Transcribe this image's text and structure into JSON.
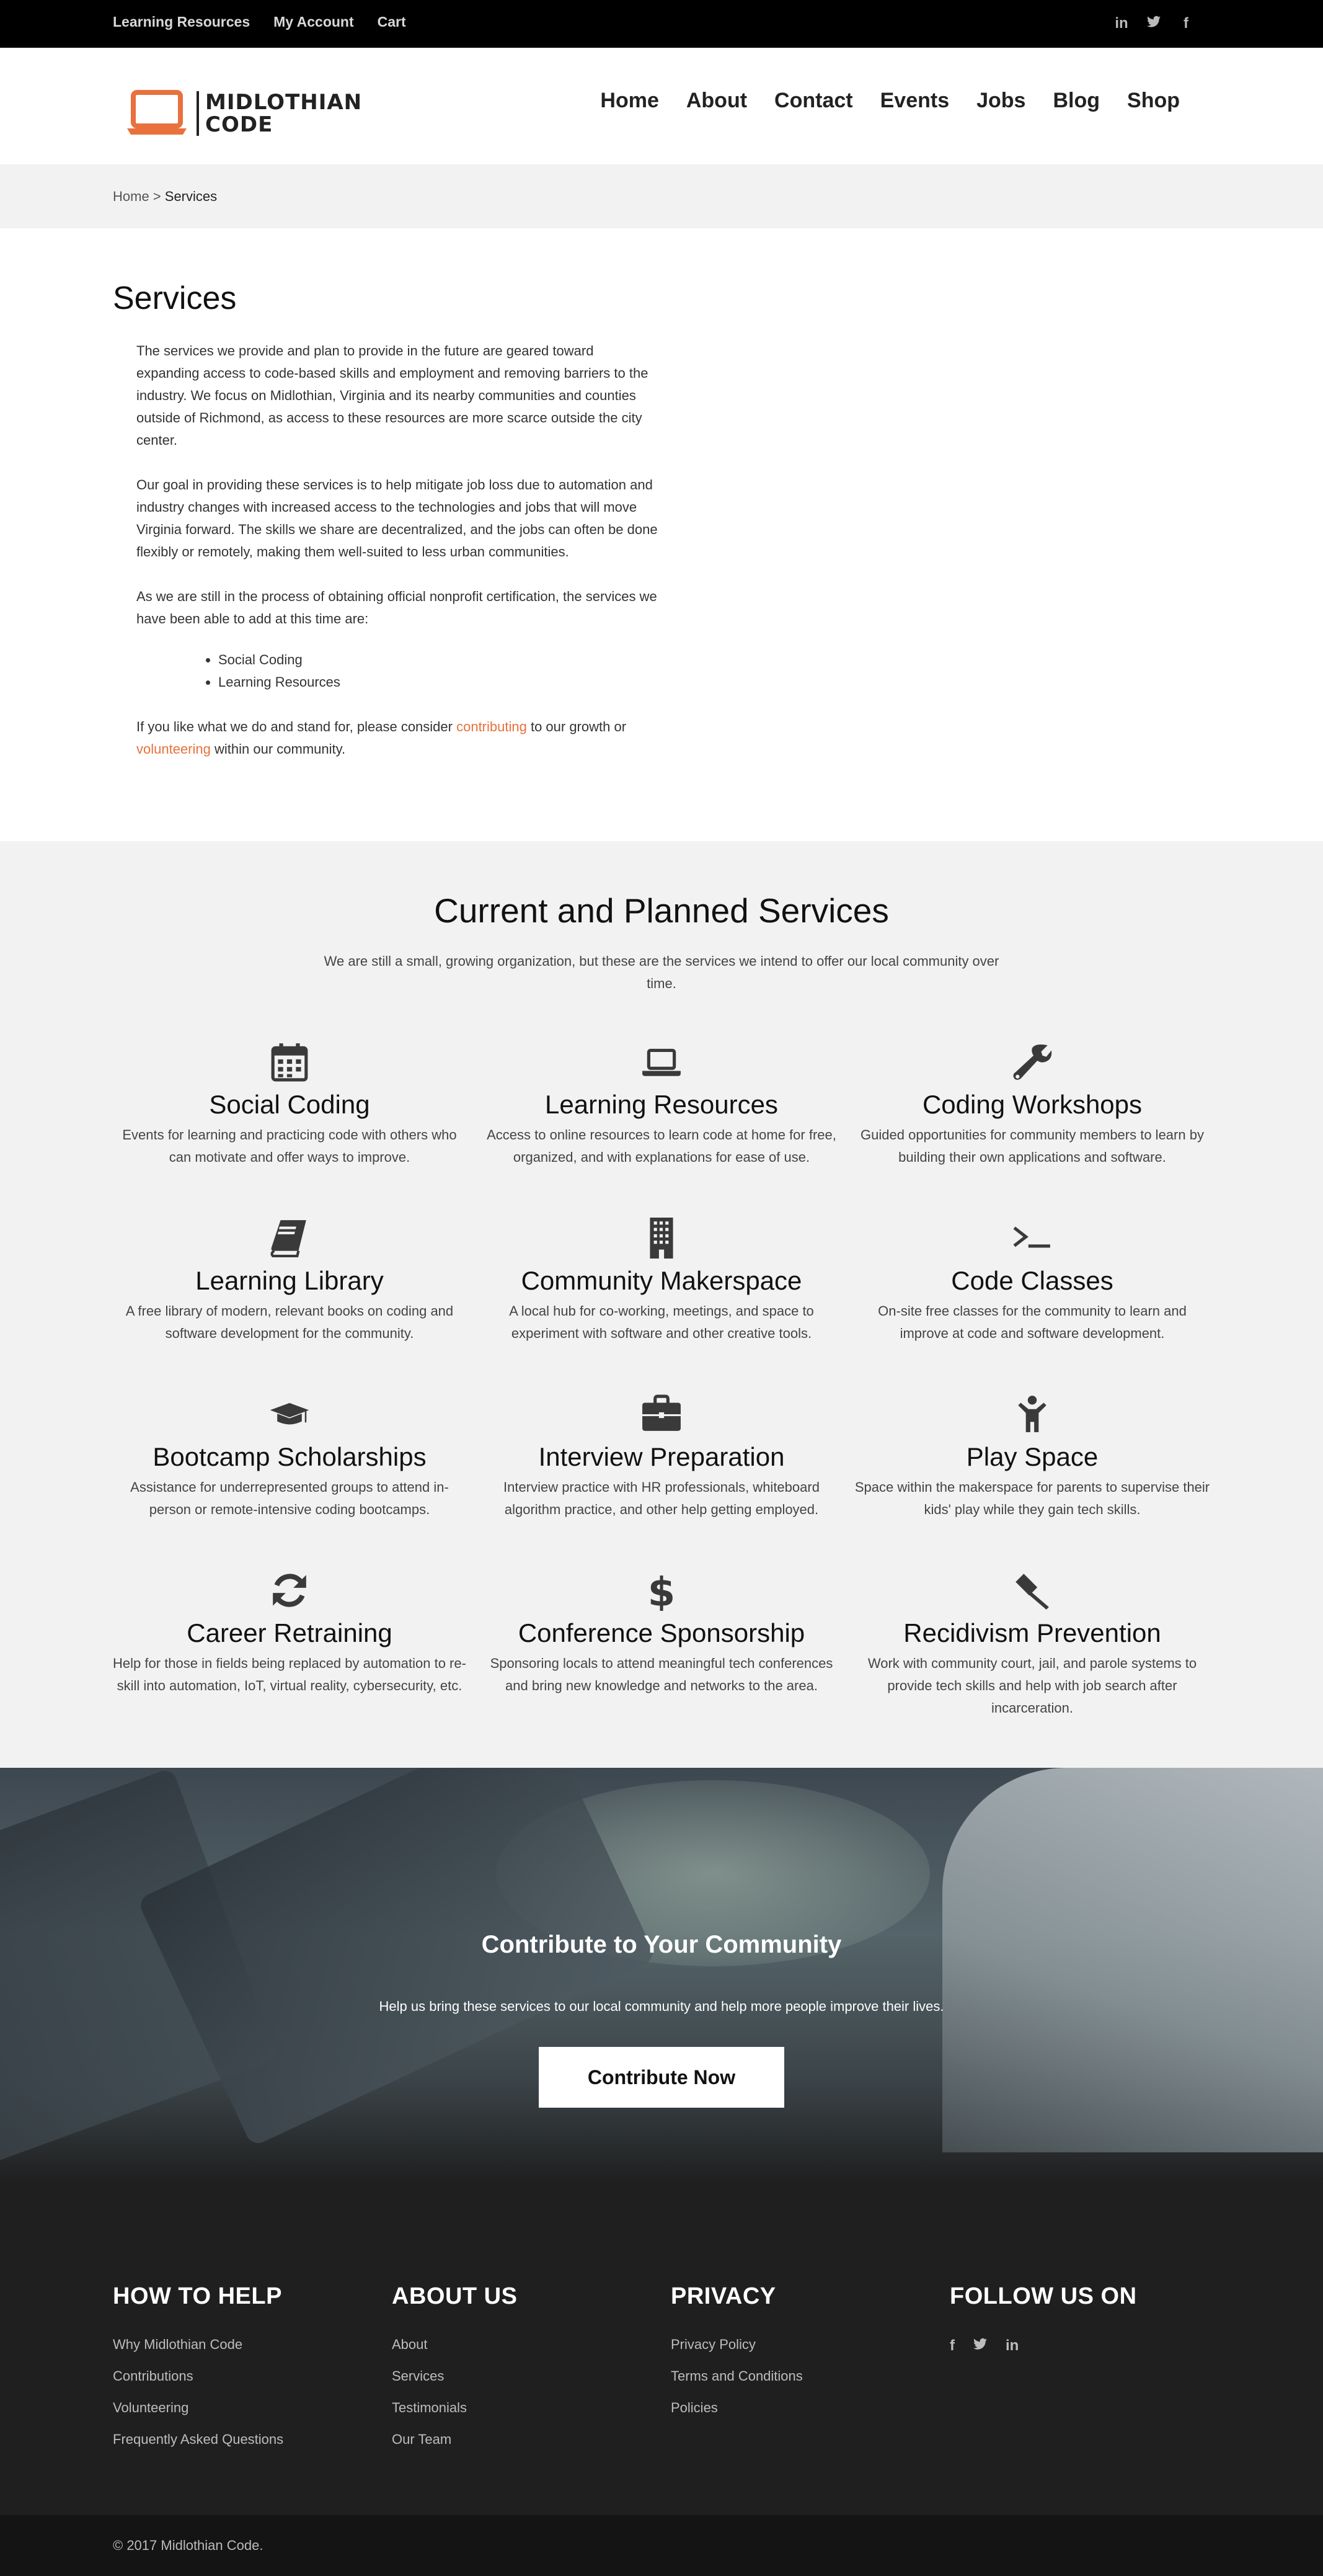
{
  "topbar": {
    "links": [
      "Learning Resources",
      "My Account",
      "Cart"
    ],
    "social": [
      "in",
      "t",
      "f"
    ]
  },
  "header": {
    "logo_line1": "MIDLOTHIAN",
    "logo_line2": "CODE",
    "nav": [
      "Home",
      "About",
      "Contact",
      "Events",
      "Jobs",
      "Blog",
      "Shop"
    ]
  },
  "breadcrumb": {
    "home": "Home",
    "sep": " > ",
    "current": "Services"
  },
  "intro": {
    "title": "Services",
    "p1": "The services we provide and plan to provide in the future are geared toward expanding access to code-based skills and employment and removing barriers to the industry. We focus on Midlothian, Virginia and its nearby communities and counties outside of Richmond, as access to these resources are more scarce outside the city center.",
    "p2": "Our goal in providing these services is to help mitigate job loss due to automation and industry changes with increased access to the technologies and jobs that will move Virginia forward. The skills we share are decentralized, and the jobs can often be done flexibly or remotely, making them well-suited to less urban communities.",
    "p3": "As we are still in the process of obtaining official nonprofit certification, the services we have been able to add at this time are:",
    "list": [
      "Social Coding",
      "Learning Resources"
    ],
    "p4_a": "If you like what we do and stand for, please consider ",
    "p4_link1": "contributing",
    "p4_b": " to our growth or ",
    "p4_link2": "volunteering",
    "p4_c": " within our community."
  },
  "services": {
    "title": "Current and Planned Services",
    "subtitle": "We are still a small, growing organization, but these are the services we intend to offer our local community over time.",
    "items": [
      {
        "title": "Social Coding",
        "desc": "Events for learning and practicing code with others who can motivate and offer ways to improve.",
        "icon": "calendar-icon"
      },
      {
        "title": "Learning Resources",
        "desc": "Access to online resources to learn code at home for free, organized, and with explanations for ease of use.",
        "icon": "laptop-icon"
      },
      {
        "title": "Coding Workshops",
        "desc": "Guided opportunities for community members to learn by building their own applications and software.",
        "icon": "wrench-icon"
      },
      {
        "title": "Learning Library",
        "desc": "A free library of modern, relevant books on coding and software development for the community.",
        "icon": "book-icon"
      },
      {
        "title": "Community Makerspace",
        "desc": "A local hub for co-working, meetings, and space to experiment with software and other creative tools.",
        "icon": "building-icon"
      },
      {
        "title": "Code Classes",
        "desc": "On-site free classes for the community to learn and improve at code and software development.",
        "icon": "terminal-icon"
      },
      {
        "title": "Bootcamp Scholarships",
        "desc": "Assistance for underrepresented groups to attend in-person or remote-intensive coding bootcamps.",
        "icon": "graduation-cap-icon"
      },
      {
        "title": "Interview Preparation",
        "desc": "Interview practice with HR professionals, whiteboard algorithm practice, and other help getting employed.",
        "icon": "briefcase-icon"
      },
      {
        "title": "Play Space",
        "desc": "Space within the makerspace for parents to supervise their kids' play while they gain tech skills.",
        "icon": "child-icon"
      },
      {
        "title": "Career Retraining",
        "desc": "Help for those in fields being replaced by automation to re-skill into automation, IoT, virtual reality, cybersecurity, etc.",
        "icon": "refresh-icon"
      },
      {
        "title": "Conference Sponsorship",
        "desc": "Sponsoring locals to attend meaningful tech conferences and bring new knowledge and networks to the area.",
        "icon": "dollar-icon"
      },
      {
        "title": "Recidivism Prevention",
        "desc": "Work with community court, jail, and parole systems to provide tech skills and help with job search after incarceration.",
        "icon": "gavel-icon"
      }
    ]
  },
  "contribute": {
    "title": "Contribute to Your Community",
    "subtitle": "Help us bring these services to our local community and help more people improve their lives.",
    "button": "Contribute Now"
  },
  "footer": {
    "how": {
      "title": "HOW TO HELP",
      "items": [
        "Why Midlothian Code",
        "Contributions",
        "Volunteering",
        "Frequently Asked Questions"
      ]
    },
    "about": {
      "title": "ABOUT US",
      "items": [
        "About",
        "Services",
        "Testimonials",
        "Our Team"
      ]
    },
    "privacy": {
      "title": "PRIVACY",
      "items": [
        "Privacy Policy",
        "Terms and Conditions",
        "Policies"
      ]
    },
    "follow": {
      "title": "FOLLOW US ON",
      "social": [
        "f",
        "t",
        "in"
      ]
    },
    "copyright": "© 2017 Midlothian Code."
  },
  "colors": {
    "accent": "#e8713d",
    "topbar": "#000000",
    "footer": "#1f1f1f",
    "section_bg": "#f2f2f2"
  }
}
